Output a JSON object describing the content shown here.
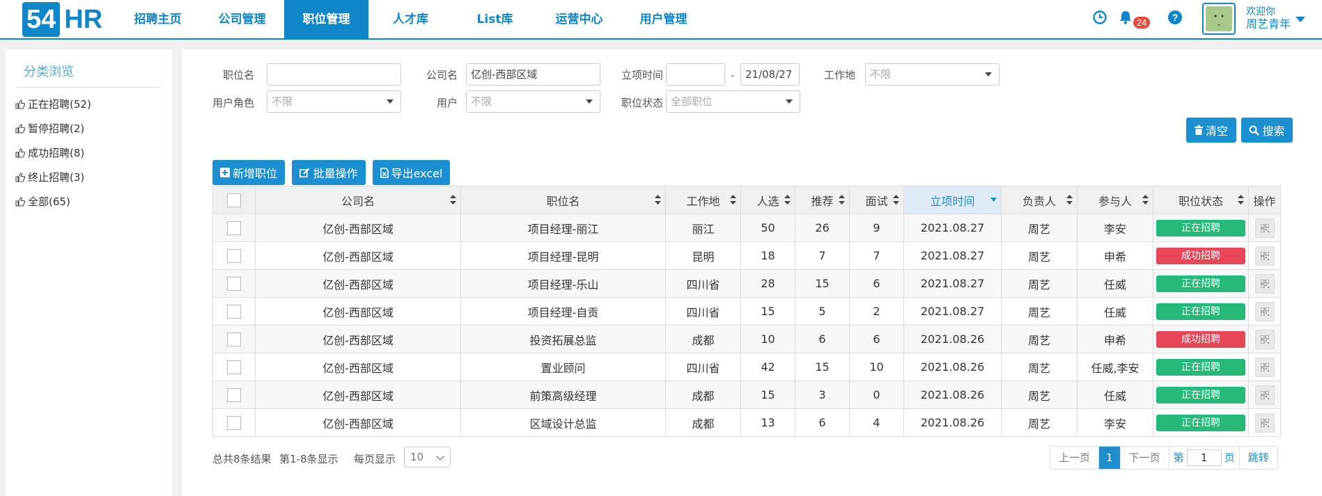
{
  "header": {
    "logo": {
      "num": "54",
      "text": "HR"
    },
    "nav": [
      "招聘主页",
      "公司管理",
      "职位管理",
      "人才库",
      "List库",
      "运营中心",
      "用户管理"
    ],
    "active_nav_index": 2,
    "notification_count": "24",
    "welcome": "欢迎你",
    "username": "周艺青年"
  },
  "sidebar": {
    "title": "分类浏览",
    "items": [
      "正在招聘(52)",
      "暂停招聘(2)",
      "成功招聘(8)",
      "终止招聘(3)",
      "全部(65)"
    ]
  },
  "filters": {
    "position_label": "职位名",
    "position_value": "",
    "company_label": "公司名",
    "company_value": "亿创-西部区域",
    "date_label": "立项时间",
    "date_from": "",
    "date_sep": "-",
    "date_to": "21/08/27",
    "location_label": "工作地",
    "location_value": "不限",
    "role_label": "用户角色",
    "role_value": "不限",
    "user_label": "用户",
    "user_value": "不限",
    "status_label": "职位状态",
    "status_value": "全部职位"
  },
  "buttons": {
    "clear": "清空",
    "search": "搜索",
    "add": "新增职位",
    "batch": "批量操作",
    "export": "导出excel"
  },
  "table": {
    "headers": [
      "公司名",
      "职位名",
      "工作地",
      "人选",
      "推荐",
      "面试",
      "立项时间",
      "负责人",
      "参与人",
      "职位状态",
      "操作"
    ],
    "rows": [
      {
        "company": "亿创-西部区域",
        "position": "项目经理-丽江",
        "location": "丽江",
        "candidates": "50",
        "recommended": "26",
        "interviews": "9",
        "date": "2021.08.27",
        "owner": "周艺",
        "participants": "李安",
        "status": "正在招聘",
        "status_color": "green"
      },
      {
        "company": "亿创-西部区域",
        "position": "项目经理-昆明",
        "location": "昆明",
        "candidates": "18",
        "recommended": "7",
        "interviews": "7",
        "date": "2021.08.27",
        "owner": "周艺",
        "participants": "申希",
        "status": "成功招聘",
        "status_color": "red"
      },
      {
        "company": "亿创-西部区域",
        "position": "项目经理-乐山",
        "location": "四川省",
        "candidates": "28",
        "recommended": "15",
        "interviews": "6",
        "date": "2021.08.27",
        "owner": "周艺",
        "participants": "任威",
        "status": "正在招聘",
        "status_color": "green"
      },
      {
        "company": "亿创-西部区域",
        "position": "项目经理-自贡",
        "location": "四川省",
        "candidates": "15",
        "recommended": "5",
        "interviews": "2",
        "date": "2021.08.27",
        "owner": "周艺",
        "participants": "任威",
        "status": "正在招聘",
        "status_color": "green"
      },
      {
        "company": "亿创-西部区域",
        "position": "投资拓展总监",
        "location": "成都",
        "candidates": "10",
        "recommended": "6",
        "interviews": "6",
        "date": "2021.08.26",
        "owner": "周艺",
        "participants": "申希",
        "status": "成功招聘",
        "status_color": "red"
      },
      {
        "company": "亿创-西部区域",
        "position": "置业顾问",
        "location": "四川省",
        "candidates": "42",
        "recommended": "15",
        "interviews": "10",
        "date": "2021.08.26",
        "owner": "周艺",
        "participants": "任威,李安",
        "status": "正在招聘",
        "status_color": "green"
      },
      {
        "company": "亿创-西部区域",
        "position": "前策高级经理",
        "location": "成都",
        "candidates": "15",
        "recommended": "3",
        "interviews": "0",
        "date": "2021.08.26",
        "owner": "周艺",
        "participants": "任威",
        "status": "正在招聘",
        "status_color": "green"
      },
      {
        "company": "亿创-西部区域",
        "position": "区域设计总监",
        "location": "成都",
        "candidates": "13",
        "recommended": "6",
        "interviews": "4",
        "date": "2021.08.26",
        "owner": "周艺",
        "participants": "李安",
        "status": "正在招聘",
        "status_color": "green"
      }
    ]
  },
  "footer": {
    "total": "总共8条结果",
    "range": "第1-8条显示",
    "per_page_label": "每页显示",
    "per_page_value": "10",
    "prev": "上一页",
    "current_page": "1",
    "next": "下一页",
    "goto_prefix": "第",
    "goto_value": "1",
    "goto_suffix": "页",
    "jump": "跳转"
  },
  "colors": {
    "brand": "#0f86c8",
    "button": "#1b8fd0",
    "status_green": "#26b97a",
    "status_red": "#e8475a",
    "badge": "#e84c3d"
  },
  "icons": [
    "clock-icon",
    "bell-icon",
    "help-icon",
    "thumbs-up-icon",
    "trash-icon",
    "search-icon",
    "plus-icon",
    "edit-icon",
    "excel-icon",
    "sort-icon",
    "qr-icon"
  ]
}
